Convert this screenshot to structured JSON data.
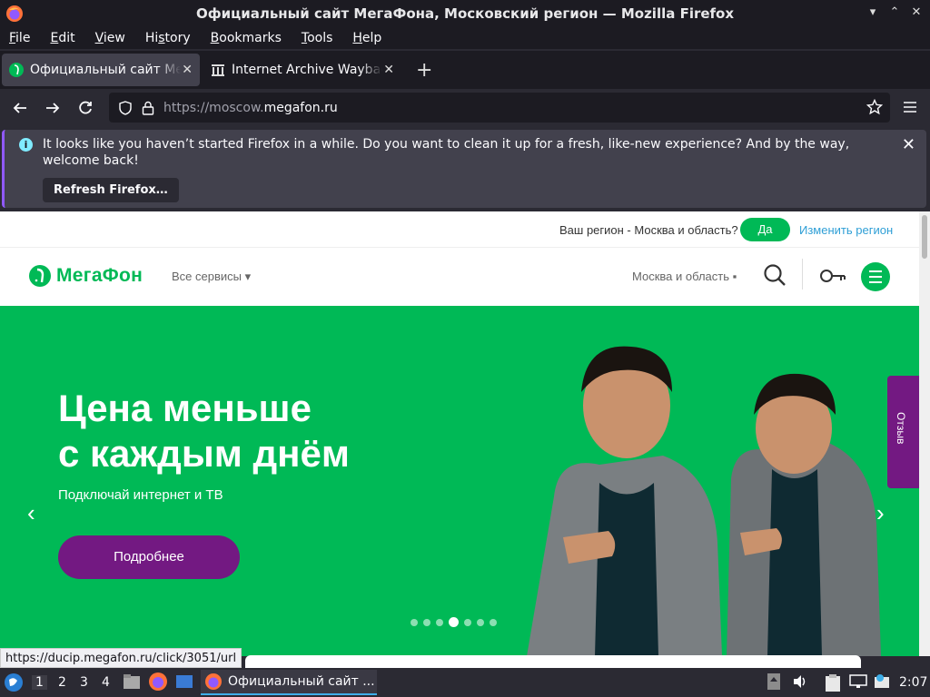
{
  "window": {
    "title": "Официальный сайт МегаФона, Московский регион — Mozilla Firefox"
  },
  "menu": [
    {
      "label": "File",
      "key": "F",
      "rest": "ile"
    },
    {
      "label": "Edit",
      "key": "E",
      "rest": "dit"
    },
    {
      "label": "View",
      "key": "V",
      "rest": "iew"
    },
    {
      "label": "History",
      "pre": "Hi",
      "key": "s",
      "rest": "tory"
    },
    {
      "label": "Bookmarks",
      "key": "B",
      "rest": "ookmarks"
    },
    {
      "label": "Tools",
      "key": "T",
      "rest": "ools"
    },
    {
      "label": "Help",
      "key": "H",
      "rest": "elp"
    }
  ],
  "tabs": [
    {
      "label": "Официальный сайт МегаФона",
      "icon": "megafon-favicon",
      "active": true
    },
    {
      "label": "Internet Archive Wayback Machine",
      "icon": "archive-favicon",
      "active": false
    }
  ],
  "urlbar": {
    "prefix": "https://moscow.",
    "domain": "megafon.ru"
  },
  "notification": {
    "message": "It looks like you haven’t started Firefox in a while. Do you want to clean it up for a fresh, like-new experience? And by the way, welcome back!",
    "button": "Refresh Firefox…"
  },
  "site": {
    "region_question": "Ваш регион - Москва и область?",
    "region_yes": "Да",
    "region_change": "Изменить регион",
    "logo_text": "МегаФон",
    "services": "Все сервисы",
    "region_select": "Москва и область",
    "hero": {
      "title_line1": "Цена меньше",
      "title_line2": "с каждым днём",
      "subtitle": "Подключай интернет и ТВ",
      "cta": "Подробнее",
      "active_slide": 4,
      "slide_count": 7
    },
    "feedback": "Отзыв",
    "colors": {
      "brand_green": "#00b956",
      "brand_purple": "#731982"
    }
  },
  "status_link": "https://ducip.megafon.ru/click/3051/url",
  "taskbar": {
    "workspaces": [
      "1",
      "2",
      "3",
      "4"
    ],
    "current_workspace": "1",
    "task_label": "Официальный сайт ...",
    "clock": "2:07"
  }
}
